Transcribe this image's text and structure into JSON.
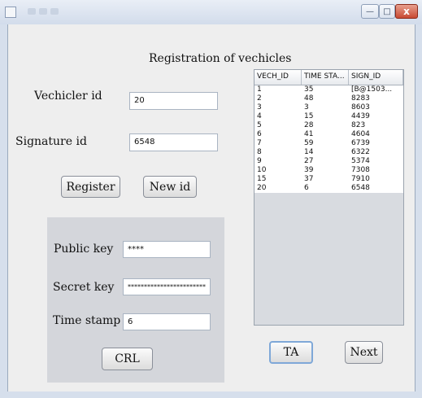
{
  "window": {
    "controls": {
      "minimize": "—",
      "maximize": "□",
      "close": "x"
    }
  },
  "form": {
    "heading": "Registration of vechicles",
    "vehicle_id_label": "Vechicler id",
    "vehicle_id_value": "20",
    "signature_id_label": "Signature id",
    "signature_id_value": "6548",
    "register_button": "Register",
    "new_id_button": "New id"
  },
  "keys": {
    "public_key_label": "Public key",
    "public_key_value": "****",
    "secret_key_label": "Secret key",
    "secret_key_value": "************************",
    "time_stamp_label": "Time stamp",
    "time_stamp_value": "6",
    "crl_button": "CRL"
  },
  "table": {
    "columns": [
      "VECH_ID",
      "TIME STA...",
      "SIGN_ID"
    ],
    "rows": [
      [
        "1",
        "35",
        "[B@1503..."
      ],
      [
        "2",
        "48",
        "8283"
      ],
      [
        "3",
        "3",
        "8603"
      ],
      [
        "4",
        "15",
        "4439"
      ],
      [
        "5",
        "28",
        "823"
      ],
      [
        "6",
        "41",
        "4604"
      ],
      [
        "7",
        "59",
        "6739"
      ],
      [
        "8",
        "14",
        "6322"
      ],
      [
        "9",
        "27",
        "5374"
      ],
      [
        "10",
        "39",
        "7308"
      ],
      [
        "15",
        "37",
        "7910"
      ],
      [
        "20",
        "6",
        "6548"
      ]
    ]
  },
  "actions": {
    "ta_button": "TA",
    "next_button": "Next"
  }
}
